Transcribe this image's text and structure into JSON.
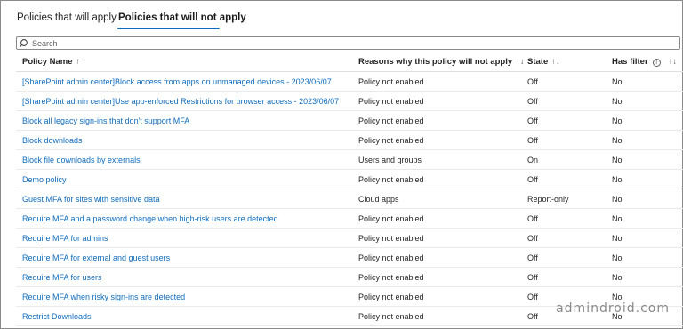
{
  "tabs": [
    {
      "label": "Policies that will apply"
    },
    {
      "label": "Policies that will not apply"
    }
  ],
  "search": {
    "placeholder": "Search"
  },
  "columns": {
    "policy_name": "Policy Name",
    "reasons": "Reasons why this policy will not apply",
    "state": "State",
    "has_filter": "Has filter",
    "sort_glyph": "↑↓",
    "sort_glyph_name": "↑"
  },
  "rows": [
    {
      "name": "[SharePoint admin center]Block access from apps on unmanaged devices - 2023/06/07",
      "reason": "Policy not enabled",
      "state": "Off",
      "filter": "No"
    },
    {
      "name": "[SharePoint admin center]Use app-enforced Restrictions for browser access - 2023/06/07",
      "reason": "Policy not enabled",
      "state": "Off",
      "filter": "No"
    },
    {
      "name": "Block all legacy sign-ins that don't support MFA",
      "reason": "Policy not enabled",
      "state": "Off",
      "filter": "No"
    },
    {
      "name": "Block downloads",
      "reason": "Policy not enabled",
      "state": "Off",
      "filter": "No"
    },
    {
      "name": "Block file downloads by externals",
      "reason": "Users and groups",
      "state": "On",
      "filter": "No"
    },
    {
      "name": "Demo policy",
      "reason": "Policy not enabled",
      "state": "Off",
      "filter": "No"
    },
    {
      "name": "Guest MFA for sites with sensitive data",
      "reason": "Cloud apps",
      "state": "Report-only",
      "filter": "No"
    },
    {
      "name": "Require MFA and a password change when high-risk users are detected",
      "reason": "Policy not enabled",
      "state": "Off",
      "filter": "No"
    },
    {
      "name": "Require MFA for admins",
      "reason": "Policy not enabled",
      "state": "Off",
      "filter": "No"
    },
    {
      "name": "Require MFA for external and guest users",
      "reason": "Policy not enabled",
      "state": "Off",
      "filter": "No"
    },
    {
      "name": "Require MFA for users",
      "reason": "Policy not enabled",
      "state": "Off",
      "filter": "No"
    },
    {
      "name": "Require MFA when risky sign-ins are detected",
      "reason": "Policy not enabled",
      "state": "Off",
      "filter": "No"
    },
    {
      "name": "Restrict Downloads",
      "reason": "Policy not enabled",
      "state": "Off",
      "filter": "No"
    }
  ],
  "watermark": "admindroid.com",
  "colors": {
    "accent": "#0f6cbd",
    "link": "#0f6cbd",
    "text": "#242424"
  },
  "icons": {
    "search": "search-icon",
    "info": "info-icon"
  }
}
